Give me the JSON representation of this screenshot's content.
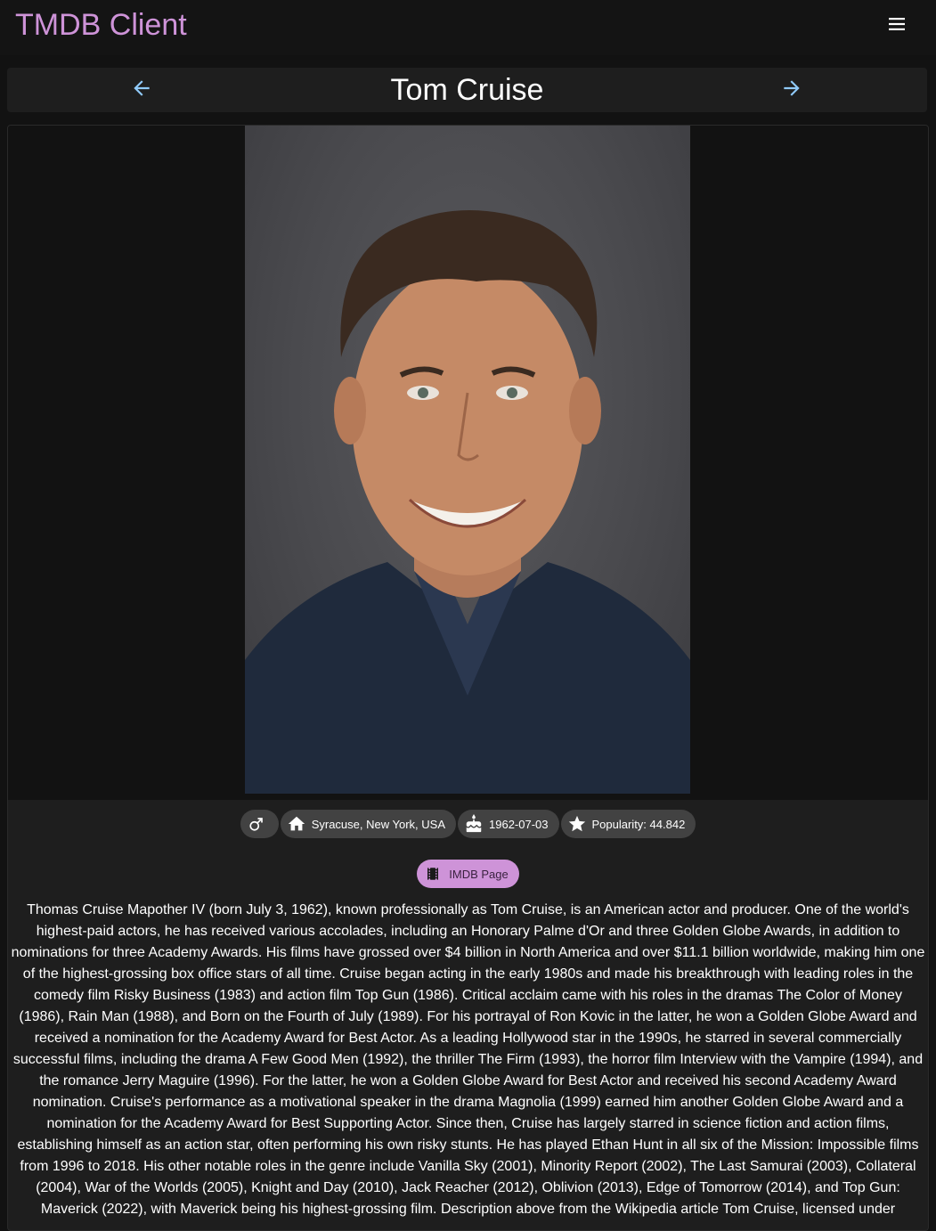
{
  "app": {
    "title": "TMDB Client",
    "accent_color": "#ce93d8",
    "menu_icon": "menu-icon"
  },
  "nav": {
    "title": "Tom Cruise",
    "prev_icon": "arrow-left-icon",
    "next_icon": "arrow-right-icon",
    "arrow_color": "#90caf9"
  },
  "person": {
    "photo": "profile-photo",
    "chips": [
      {
        "icon": "male-icon",
        "label": ""
      },
      {
        "icon": "home-icon",
        "label": "Syracuse, New York, USA"
      },
      {
        "icon": "cake-icon",
        "label": "1962-07-03"
      },
      {
        "icon": "star-icon",
        "label": "Popularity: 44.842"
      }
    ],
    "imdb_button": {
      "icon": "film-icon",
      "label": "IMDB Page"
    },
    "biography": "Thomas Cruise Mapother IV (born July 3, 1962), known professionally as Tom Cruise, is an American actor and producer. One of the world's highest-paid actors, he has received various accolades, including an Honorary Palme d'Or and three Golden Globe Awards, in addition to nominations for three Academy Awards. His films have grossed over $4 billion in North America and over $11.1 billion worldwide, making him one of the highest-grossing box office stars of all time. Cruise began acting in the early 1980s and made his breakthrough with leading roles in the comedy film Risky Business (1983) and action film Top Gun (1986). Critical acclaim came with his roles in the dramas The Color of Money (1986), Rain Man (1988), and Born on the Fourth of July (1989). For his portrayal of Ron Kovic in the latter, he won a Golden Globe Award and received a nomination for the Academy Award for Best Actor. As a leading Hollywood star in the 1990s, he starred in several commercially successful films, including the drama A Few Good Men (1992), the thriller The Firm (1993), the horror film Interview with the Vampire (1994), and the romance Jerry Maguire (1996). For the latter, he won a Golden Globe Award for Best Actor and received his second Academy Award nomination. Cruise's performance as a motivational speaker in the drama Magnolia (1999) earned him another Golden Globe Award and a nomination for the Academy Award for Best Supporting Actor. Since then, Cruise has largely starred in science fiction and action films, establishing himself as an action star, often performing his own risky stunts. He has played Ethan Hunt in all six of the Mission: Impossible films from 1996 to 2018. His other notable roles in the genre include Vanilla Sky (2001), Minority Report (2002), The Last Samurai (2003), Collateral (2004), War of the Worlds (2005), Knight and Day (2010), Jack Reacher (2012), Oblivion (2013), Edge of Tomorrow (2014), and Top Gun: Maverick (2022), with Maverick being his highest-grossing film. Description above from the Wikipedia article Tom Cruise, licensed under"
  }
}
